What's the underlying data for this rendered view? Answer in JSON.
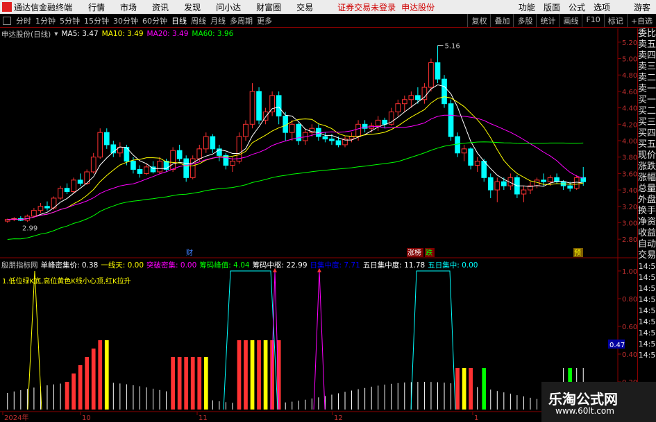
{
  "menubar": {
    "app_title": "通达信金融终端",
    "items": [
      "行情",
      "市场",
      "资讯",
      "发现",
      "问小达",
      "财富圈",
      "交易"
    ],
    "warning": "证券交易未登录",
    "stock": "申达股份",
    "right_items": [
      "功能",
      "版面",
      "公式",
      "选项"
    ],
    "user": "游客"
  },
  "toolbar": {
    "periods": [
      "分时",
      "1分钟",
      "5分钟",
      "15分钟",
      "30分钟",
      "60分钟",
      "日线",
      "周线",
      "月线",
      "多周期",
      "更多"
    ],
    "active_period": "日线",
    "right_items": [
      "复权",
      "叠加",
      "多股",
      "统计",
      "画线",
      "F10",
      "标记",
      "+自选"
    ]
  },
  "chart_header": {
    "name": "申达股份(日线)",
    "ma5": "MA5: 3.47",
    "ma10": "MA10: 3.49",
    "ma20": "MA20: 3.49",
    "ma60": "MA60: 3.96"
  },
  "ind_header": {
    "name": "殷朋指标网",
    "items": [
      {
        "label": "单峰密集价: 0.38",
        "color": "#ffffff"
      },
      {
        "label": "一线天: 0.00",
        "color": "#ffff00"
      },
      {
        "label": "突破密集: 0.00",
        "color": "#ff00ff"
      },
      {
        "label": "筹码峰值: 4.04",
        "color": "#00ff00"
      },
      {
        "label": "筹码中枢: 22.99",
        "color": "#ffffff"
      },
      {
        "label": "日集中度: 7.71",
        "color": "#0000ff"
      },
      {
        "label": "五日集中度: 11.78",
        "color": "#ffffff"
      },
      {
        "label": "五日集中: 0.00",
        "color": "#00ffff"
      }
    ]
  },
  "ind_desc": "1.低位绿K底,高位黄色K线小心顶,红K拉升",
  "side_panel": [
    "委比",
    "卖五",
    "卖四",
    "卖三",
    "卖二",
    "卖一",
    "买一",
    "买二",
    "买三",
    "买四",
    "买五",
    "现价",
    "涨跌",
    "涨幅",
    "总量",
    "外盘",
    "换手",
    "净资",
    "收益",
    "自动",
    "交易",
    "14:5",
    "14:5",
    "14:5",
    "14:5",
    "14:5",
    "14:5",
    "14:5",
    "14:5",
    "14:5"
  ],
  "price_axis": [
    "5.20",
    "5.00",
    "4.80",
    "4.60",
    "4.40",
    "4.20",
    "4.00",
    "3.80",
    "3.60",
    "3.40",
    "3.20",
    "3.00",
    "2.80"
  ],
  "ind_axis": [
    "1.00",
    "0.80",
    "0.60",
    "0.47",
    "0.40",
    "0.20"
  ],
  "x_axis": [
    "2024年",
    "10",
    "11",
    "12",
    "1"
  ],
  "annotations": {
    "high": "5.16",
    "low": "2.99",
    "cai": "财",
    "zhang": "涨榜",
    "die": "跌",
    "yu": "预"
  },
  "watermark": {
    "title": "乐淘公式网",
    "url": "www.60lt.com"
  },
  "chart_data": {
    "type": "candlestick",
    "ylim": [
      2.7,
      5.3
    ],
    "high": 5.16,
    "low": 2.99,
    "ohlc": [
      [
        3.02,
        3.05,
        3.0,
        3.04
      ],
      [
        3.04,
        3.07,
        3.02,
        3.05
      ],
      [
        3.05,
        3.08,
        3.02,
        3.03
      ],
      [
        3.03,
        3.1,
        3.01,
        3.08
      ],
      [
        3.08,
        3.18,
        3.06,
        3.15
      ],
      [
        3.15,
        3.24,
        3.12,
        3.2
      ],
      [
        3.2,
        3.26,
        3.15,
        3.18
      ],
      [
        3.18,
        3.32,
        3.16,
        3.3
      ],
      [
        3.3,
        3.45,
        3.28,
        3.42
      ],
      [
        3.42,
        3.48,
        3.35,
        3.38
      ],
      [
        3.38,
        3.55,
        3.36,
        3.52
      ],
      [
        3.52,
        3.6,
        3.45,
        3.48
      ],
      [
        3.48,
        3.65,
        3.46,
        3.62
      ],
      [
        3.62,
        3.85,
        3.6,
        3.8
      ],
      [
        3.8,
        4.15,
        3.78,
        4.1
      ],
      [
        4.1,
        4.15,
        3.9,
        3.95
      ],
      [
        3.95,
        4.0,
        3.8,
        3.85
      ],
      [
        3.85,
        3.98,
        3.8,
        3.92
      ],
      [
        3.92,
        3.95,
        3.7,
        3.75
      ],
      [
        3.75,
        3.8,
        3.6,
        3.65
      ],
      [
        3.65,
        3.7,
        3.55,
        3.6
      ],
      [
        3.6,
        3.72,
        3.58,
        3.68
      ],
      [
        3.68,
        3.75,
        3.6,
        3.62
      ],
      [
        3.62,
        3.8,
        3.6,
        3.75
      ],
      [
        3.75,
        3.78,
        3.62,
        3.65
      ],
      [
        3.65,
        3.92,
        3.62,
        3.88
      ],
      [
        3.88,
        3.95,
        3.75,
        3.78
      ],
      [
        3.78,
        3.82,
        3.5,
        3.55
      ],
      [
        3.55,
        3.82,
        3.53,
        3.78
      ],
      [
        3.78,
        3.95,
        3.75,
        3.9
      ],
      [
        3.9,
        4.1,
        3.85,
        4.05
      ],
      [
        4.05,
        4.08,
        3.85,
        3.9
      ],
      [
        3.9,
        3.95,
        3.75,
        3.82
      ],
      [
        3.82,
        3.85,
        3.65,
        3.7
      ],
      [
        3.7,
        3.8,
        3.62,
        3.75
      ],
      [
        3.75,
        4.1,
        3.72,
        4.05
      ],
      [
        4.05,
        4.25,
        4.0,
        4.2
      ],
      [
        4.2,
        4.7,
        4.15,
        4.6
      ],
      [
        4.6,
        4.65,
        4.2,
        4.25
      ],
      [
        4.25,
        4.4,
        4.2,
        4.35
      ],
      [
        4.35,
        4.6,
        4.3,
        4.55
      ],
      [
        4.55,
        4.6,
        4.2,
        4.3
      ],
      [
        4.3,
        4.35,
        4.0,
        4.1
      ],
      [
        4.1,
        4.25,
        4.0,
        4.2
      ],
      [
        4.2,
        4.22,
        3.95,
        4.0
      ],
      [
        4.0,
        4.15,
        3.95,
        4.1
      ],
      [
        4.1,
        4.2,
        4.05,
        4.15
      ],
      [
        4.15,
        4.2,
        4.0,
        4.05
      ],
      [
        4.05,
        4.1,
        3.98,
        4.02
      ],
      [
        4.02,
        4.08,
        3.95,
        4.0
      ],
      [
        4.0,
        4.05,
        3.92,
        3.95
      ],
      [
        3.95,
        4.05,
        3.92,
        4.02
      ],
      [
        4.02,
        4.1,
        3.98,
        4.05
      ],
      [
        4.05,
        4.25,
        4.0,
        4.2
      ],
      [
        4.2,
        4.25,
        4.1,
        4.15
      ],
      [
        4.15,
        4.22,
        4.1,
        4.18
      ],
      [
        4.18,
        4.3,
        4.12,
        4.25
      ],
      [
        4.25,
        4.28,
        4.15,
        4.2
      ],
      [
        4.2,
        4.4,
        4.18,
        4.35
      ],
      [
        4.35,
        4.5,
        4.3,
        4.45
      ],
      [
        4.45,
        4.55,
        4.35,
        4.5
      ],
      [
        4.5,
        4.6,
        4.4,
        4.55
      ],
      [
        4.55,
        4.65,
        4.45,
        4.5
      ],
      [
        4.5,
        4.7,
        4.45,
        4.65
      ],
      [
        4.65,
        5.0,
        4.6,
        4.95
      ],
      [
        4.95,
        5.16,
        4.7,
        4.75
      ],
      [
        4.75,
        4.8,
        4.4,
        4.45
      ],
      [
        4.45,
        4.5,
        4.0,
        4.05
      ],
      [
        4.05,
        4.1,
        3.8,
        3.85
      ],
      [
        3.85,
        3.95,
        3.75,
        3.9
      ],
      [
        3.9,
        3.92,
        3.65,
        3.7
      ],
      [
        3.7,
        3.8,
        3.62,
        3.75
      ],
      [
        3.75,
        3.78,
        3.5,
        3.55
      ],
      [
        3.55,
        3.6,
        3.3,
        3.4
      ],
      [
        3.4,
        3.55,
        3.25,
        3.5
      ],
      [
        3.5,
        3.55,
        3.4,
        3.45
      ],
      [
        3.45,
        3.6,
        3.4,
        3.55
      ],
      [
        3.55,
        3.58,
        3.3,
        3.35
      ],
      [
        3.35,
        3.45,
        3.25,
        3.4
      ],
      [
        3.4,
        3.5,
        3.35,
        3.45
      ],
      [
        3.45,
        3.55,
        3.42,
        3.52
      ],
      [
        3.52,
        3.6,
        3.45,
        3.5
      ],
      [
        3.5,
        3.58,
        3.45,
        3.55
      ],
      [
        3.55,
        3.6,
        3.48,
        3.5
      ],
      [
        3.5,
        3.52,
        3.4,
        3.45
      ],
      [
        3.45,
        3.5,
        3.38,
        3.42
      ],
      [
        3.42,
        3.58,
        3.4,
        3.55
      ],
      [
        3.55,
        3.68,
        3.45,
        3.5
      ]
    ]
  }
}
